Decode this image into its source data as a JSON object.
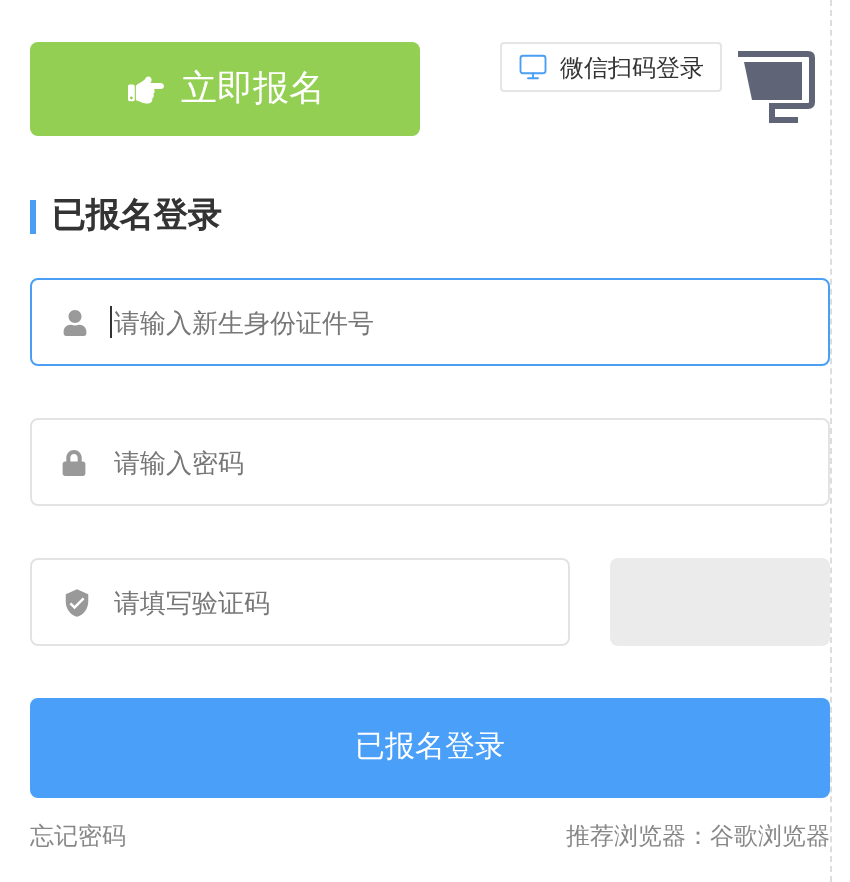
{
  "signup_button": {
    "label": "立即报名"
  },
  "qr_login": {
    "label": "微信扫码登录"
  },
  "section_title": "已报名登录",
  "fields": [
    {
      "kind": "user",
      "placeholder": "请输入新生身份证件号",
      "focused": true
    },
    {
      "kind": "lock",
      "placeholder": "请输入密码",
      "focused": false
    },
    {
      "kind": "shield",
      "placeholder": "请填写验证码",
      "focused": false
    }
  ],
  "login_button": {
    "label": "已报名登录"
  },
  "forgot_password": "忘记密码",
  "browser_tip": "推荐浏览器：谷歌浏览器"
}
